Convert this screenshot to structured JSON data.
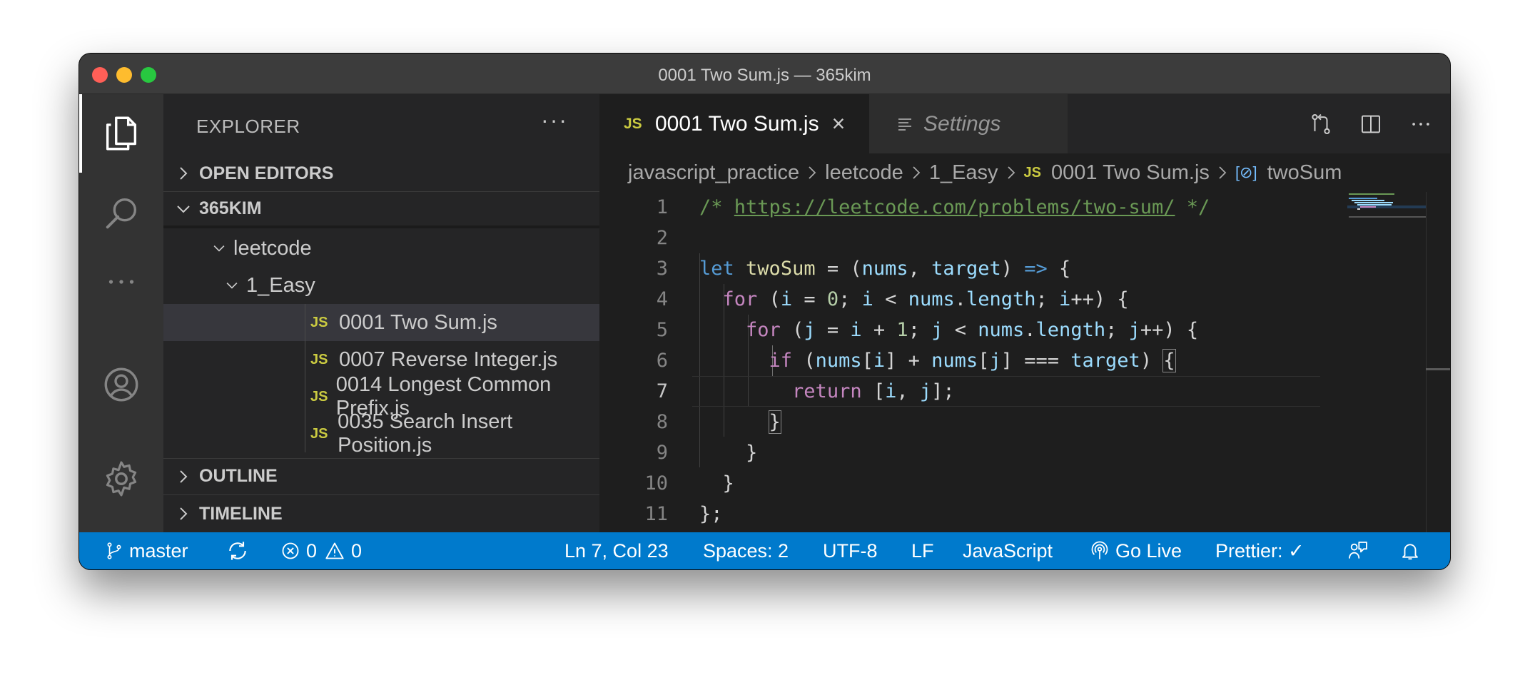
{
  "window": {
    "title": "0001 Two Sum.js — 365kim"
  },
  "sidebar": {
    "title": "EXPLORER",
    "more": "···",
    "sections": {
      "open_editors": "OPEN EDITORS",
      "workspace": "365KIM",
      "outline": "OUTLINE",
      "timeline": "TIMELINE"
    },
    "tree": {
      "folder1": "leetcode",
      "folder2": "1_Easy",
      "files": [
        "0001 Two Sum.js",
        "0007 Reverse Integer.js",
        "0014 Longest Common Prefix.js",
        "0035 Search Insert Position.js"
      ],
      "js_badge": "JS"
    }
  },
  "tabs": {
    "active": {
      "badge": "JS",
      "label": "0001 Two Sum.js",
      "close": "×"
    },
    "inactive": {
      "label": "Settings"
    }
  },
  "breadcrumb": {
    "items": [
      "javascript_practice",
      "leetcode",
      "1_Easy",
      "0001 Two Sum.js",
      "twoSum"
    ],
    "js_badge": "JS",
    "symbol_badge": "[⊘]"
  },
  "editor": {
    "line_numbers": [
      "1",
      "2",
      "3",
      "4",
      "5",
      "6",
      "7",
      "8",
      "9",
      "10",
      "11"
    ],
    "current_line": 7,
    "comment_open": "/* ",
    "comment_url": "https://leetcode.com/problems/two-sum/",
    "comment_close": " */"
  },
  "status": {
    "branch": "master",
    "errors": "0",
    "warnings": "0",
    "position": "Ln 7, Col 23",
    "spaces": "Spaces: 2",
    "encoding": "UTF-8",
    "eol": "LF",
    "language": "JavaScript",
    "golive": "Go Live",
    "prettier": "Prettier: ✓"
  },
  "colors": {
    "statusbar": "#007acc",
    "activitybar": "#333333",
    "sidebar": "#252526",
    "editor": "#1e1e1e",
    "js_badge": "#cbcb41"
  }
}
